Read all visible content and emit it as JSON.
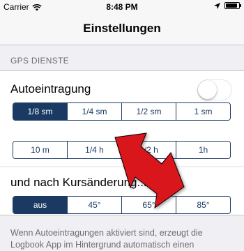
{
  "status": {
    "carrier": "Carrier",
    "time": "8:48 PM",
    "battery_level": 0.9
  },
  "nav": {
    "title": "Einstellungen"
  },
  "gps": {
    "header": "GPS DIENSTE",
    "auto_label": "Autoeintragung",
    "auto_enabled": false,
    "distance_options": [
      "1/8 sm",
      "1/4 sm",
      "1/2 sm",
      "1 sm"
    ],
    "distance_selected": 0,
    "time_options": [
      "10 m",
      "1/4 h",
      "1/2 h",
      "1h"
    ],
    "time_selected": -1
  },
  "course": {
    "label": "und nach Kursänderung...",
    "options": [
      "aus",
      "45°",
      "65°",
      "85°"
    ],
    "selected": 0
  },
  "footer": {
    "text": "Wenn Autoeintragungen aktiviert sind, erzeugt die Logbook App im Hintergrund automatisch einen"
  },
  "colors": {
    "accent": "#1a3a63",
    "arrow": "#d9121b"
  }
}
